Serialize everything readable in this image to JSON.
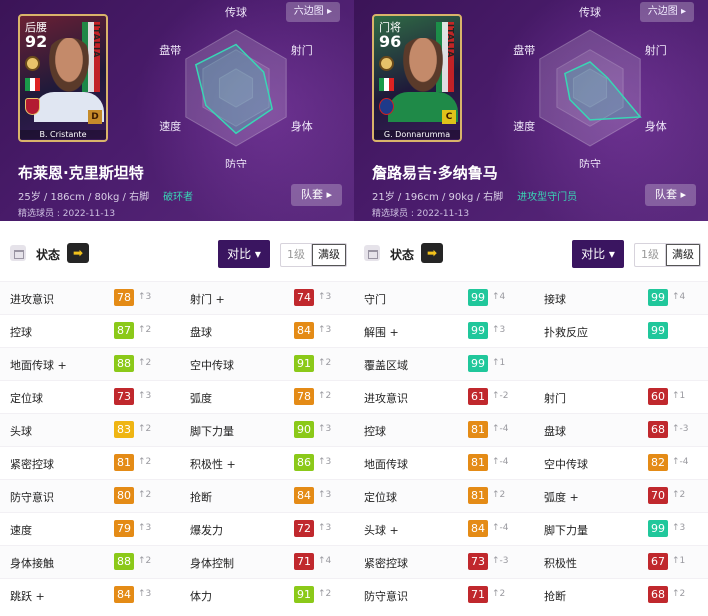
{
  "ui": {
    "hexagon_label": "六边图 ▸",
    "squad_label": "队套 ▸",
    "status_label": "状态",
    "arrow_glyph": "➡",
    "compare_label": "对比 ▾",
    "level_label": "1级",
    "max_level_label": "满级"
  },
  "radar_labels": {
    "top": "传球",
    "top_right": "射门",
    "bottom_right": "身体",
    "bottom": "防守",
    "bottom_left": "速度",
    "top_left": "盘带"
  },
  "players": [
    {
      "card": {
        "position": "后腰",
        "overall": "92",
        "name": "B. Cristante",
        "rank": "D",
        "nation": "ITALIA"
      },
      "radar_values": [
        0.75,
        0.55,
        0.72,
        0.78,
        0.6,
        0.8
      ],
      "name": "布莱恩·克里斯坦特",
      "info": "25岁 / 186cm / 80kg / 右脚",
      "role": "破环者",
      "featured": "精选球员 : 2022-11-13",
      "accent": "#39d6b5",
      "stats": [
        {
          "label": "进攻意识",
          "value": "78",
          "delta": "↑3",
          "color": "orange"
        },
        {
          "label": "射门 +",
          "value": "74",
          "delta": "↑3",
          "color": "red"
        },
        {
          "label": "控球",
          "value": "87",
          "delta": "↑2",
          "color": "lime"
        },
        {
          "label": "盘球",
          "value": "84",
          "delta": "↑3",
          "color": "orange"
        },
        {
          "label": "地面传球 +",
          "value": "88",
          "delta": "↑2",
          "color": "lime"
        },
        {
          "label": "空中传球",
          "value": "91",
          "delta": "↑2",
          "color": "lime"
        },
        {
          "label": "定位球",
          "value": "73",
          "delta": "↑3",
          "color": "red"
        },
        {
          "label": "弧度",
          "value": "78",
          "delta": "↑2",
          "color": "orange"
        },
        {
          "label": "头球",
          "value": "83",
          "delta": "↑2",
          "color": "yellow"
        },
        {
          "label": "脚下力量",
          "value": "90",
          "delta": "↑3",
          "color": "lime"
        },
        {
          "label": "紧密控球",
          "value": "81",
          "delta": "↑2",
          "color": "orange"
        },
        {
          "label": "积极性 +",
          "value": "86",
          "delta": "↑3",
          "color": "lime"
        },
        {
          "label": "防守意识",
          "value": "80",
          "delta": "↑2",
          "color": "orange"
        },
        {
          "label": "抢断",
          "value": "84",
          "delta": "↑3",
          "color": "orange"
        },
        {
          "label": "速度",
          "value": "79",
          "delta": "↑3",
          "color": "orange"
        },
        {
          "label": "爆发力",
          "value": "72",
          "delta": "↑3",
          "color": "red"
        },
        {
          "label": "身体接触",
          "value": "88",
          "delta": "↑2",
          "color": "lime"
        },
        {
          "label": "身体控制",
          "value": "71",
          "delta": "↑4",
          "color": "red"
        },
        {
          "label": "跳跃 +",
          "value": "84",
          "delta": "↑3",
          "color": "orange"
        },
        {
          "label": "体力",
          "value": "91",
          "delta": "↑2",
          "color": "lime"
        }
      ]
    },
    {
      "card": {
        "position": "门将",
        "overall": "96",
        "name": "G. Donnarumma",
        "rank": "C",
        "nation": "ITALIA"
      },
      "radar_values": [
        0.45,
        0.35,
        1.0,
        0.55,
        0.4,
        0.5
      ],
      "name": "詹路易吉·多纳鲁马",
      "info": "21岁 / 196cm / 90kg / 右脚",
      "role": "进攻型守门员",
      "featured": "精选球员 : 2022-11-13",
      "accent": "#39d6b5",
      "stats": [
        {
          "label": "守门",
          "value": "99",
          "delta": "↑4",
          "color": "teal"
        },
        {
          "label": "接球",
          "value": "99",
          "delta": "↑4",
          "color": "teal"
        },
        {
          "label": "解围 +",
          "value": "99",
          "delta": "↑3",
          "color": "teal"
        },
        {
          "label": "扑救反应",
          "value": "99",
          "delta": "",
          "color": "teal"
        },
        {
          "label": "覆盖区域",
          "value": "99",
          "delta": "↑1",
          "color": "teal"
        },
        {
          "label": "",
          "value": "",
          "delta": "",
          "color": ""
        },
        {
          "label": "进攻意识",
          "value": "61",
          "delta": "↑-2",
          "color": "red"
        },
        {
          "label": "射门",
          "value": "60",
          "delta": "↑1",
          "color": "red"
        },
        {
          "label": "控球",
          "value": "81",
          "delta": "↑-4",
          "color": "orange"
        },
        {
          "label": "盘球",
          "value": "68",
          "delta": "↑-3",
          "color": "red"
        },
        {
          "label": "地面传球",
          "value": "81",
          "delta": "↑-4",
          "color": "orange"
        },
        {
          "label": "空中传球",
          "value": "82",
          "delta": "↑-4",
          "color": "orange"
        },
        {
          "label": "定位球",
          "value": "81",
          "delta": "↑2",
          "color": "orange"
        },
        {
          "label": "弧度 +",
          "value": "70",
          "delta": "↑2",
          "color": "red"
        },
        {
          "label": "头球 +",
          "value": "84",
          "delta": "↑-4",
          "color": "orange"
        },
        {
          "label": "脚下力量",
          "value": "99",
          "delta": "↑3",
          "color": "teal"
        },
        {
          "label": "紧密控球",
          "value": "73",
          "delta": "↑-3",
          "color": "red"
        },
        {
          "label": "积极性",
          "value": "67",
          "delta": "↑1",
          "color": "red"
        },
        {
          "label": "防守意识",
          "value": "71",
          "delta": "↑2",
          "color": "red"
        },
        {
          "label": "抢断",
          "value": "68",
          "delta": "↑2",
          "color": "red"
        }
      ]
    }
  ]
}
